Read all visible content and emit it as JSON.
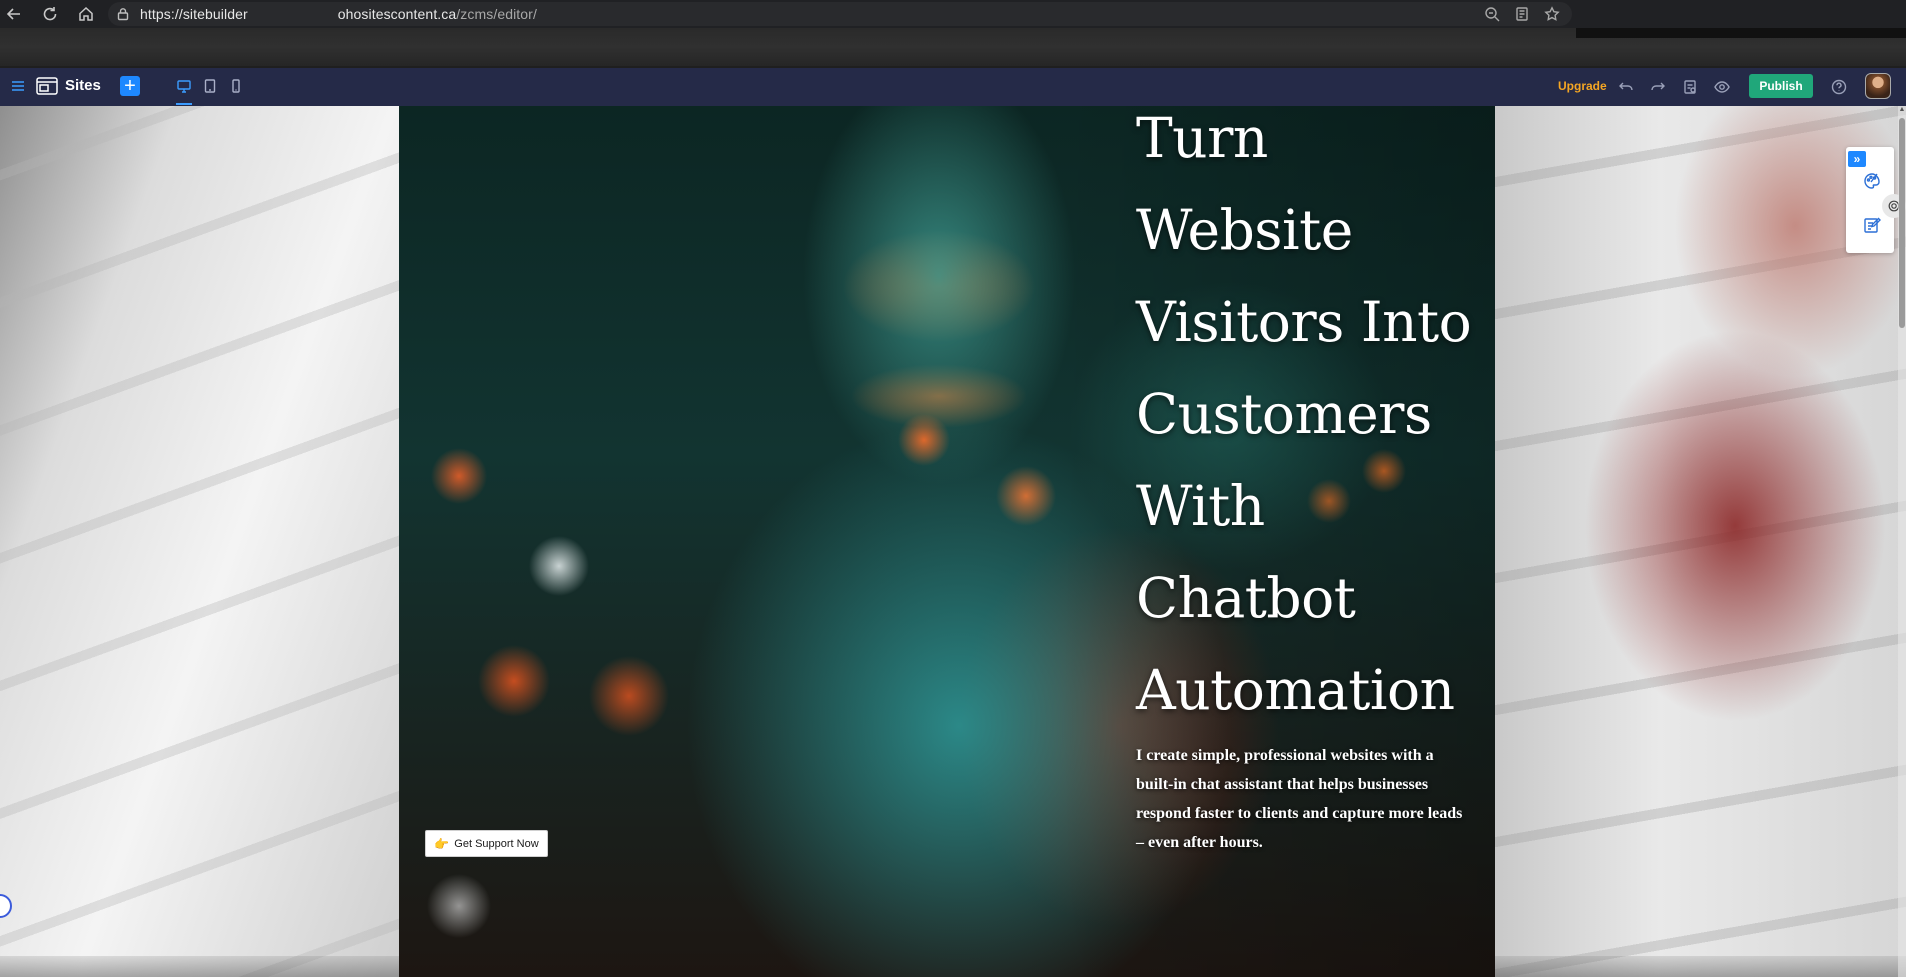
{
  "browser": {
    "url_prefix": "https://sitebuilder",
    "url_domain": "ohositescontent.ca",
    "url_path": "/zcms/editor/",
    "back_icon": "back-arrow-icon",
    "reload_icon": "reload-icon",
    "home_icon": "home-icon"
  },
  "toolbar": {
    "menu_icon": "hamburger-menu-icon",
    "sites_label": "Sites",
    "add_label": "+",
    "devices": [
      "desktop",
      "tablet",
      "mobile"
    ],
    "active_device": "desktop",
    "upgrade_label": "Upgrade",
    "publish_label": "Publish",
    "accent_color": "#1e88ff",
    "publish_color": "#20a77a",
    "upgrade_color": "#f5a623"
  },
  "hero": {
    "headline_lines": [
      "Turn",
      "Website",
      "Visitors Into",
      "Customers",
      "With",
      "Chatbot",
      "Automation"
    ],
    "subtext": "I create simple, professional websites with a built-in chat assistant that helps businesses respond faster to clients and capture more leads – even after hours.",
    "cta_icon": "👉",
    "cta_label": "Get Support Now"
  },
  "side_panel": {
    "collapse_label": "»"
  }
}
